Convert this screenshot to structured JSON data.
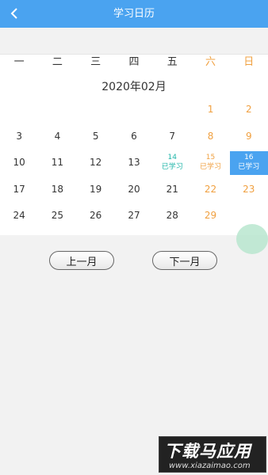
{
  "header": {
    "title": "学习日历",
    "back_icon": "chevron-left-icon"
  },
  "weekdays": [
    {
      "label": "一",
      "weekend": false
    },
    {
      "label": "二",
      "weekend": false
    },
    {
      "label": "三",
      "weekend": false
    },
    {
      "label": "四",
      "weekend": false
    },
    {
      "label": "五",
      "weekend": false
    },
    {
      "label": "六",
      "weekend": true
    },
    {
      "label": "日",
      "weekend": true
    }
  ],
  "calendar": {
    "month_label": "2020年02月",
    "studied_label": "已学习",
    "days": [
      {
        "day": "1",
        "col": 5,
        "row": 0,
        "weekend": true
      },
      {
        "day": "2",
        "col": 6,
        "row": 0,
        "weekend": true
      },
      {
        "day": "3",
        "col": 0,
        "row": 1
      },
      {
        "day": "4",
        "col": 1,
        "row": 1
      },
      {
        "day": "5",
        "col": 2,
        "row": 1
      },
      {
        "day": "6",
        "col": 3,
        "row": 1
      },
      {
        "day": "7",
        "col": 4,
        "row": 1
      },
      {
        "day": "8",
        "col": 5,
        "row": 1,
        "weekend": true
      },
      {
        "day": "9",
        "col": 6,
        "row": 1,
        "weekend": true
      },
      {
        "day": "10",
        "col": 0,
        "row": 2
      },
      {
        "day": "11",
        "col": 1,
        "row": 2
      },
      {
        "day": "12",
        "col": 2,
        "row": 2
      },
      {
        "day": "13",
        "col": 3,
        "row": 2
      },
      {
        "day": "14",
        "col": 4,
        "row": 2,
        "studied": true,
        "style": "teal"
      },
      {
        "day": "15",
        "col": 5,
        "row": 2,
        "studied": true,
        "weekend": true
      },
      {
        "day": "16",
        "col": 6,
        "row": 2,
        "studied": true,
        "selected": true
      },
      {
        "day": "17",
        "col": 0,
        "row": 3
      },
      {
        "day": "18",
        "col": 1,
        "row": 3
      },
      {
        "day": "19",
        "col": 2,
        "row": 3
      },
      {
        "day": "20",
        "col": 3,
        "row": 3
      },
      {
        "day": "21",
        "col": 4,
        "row": 3
      },
      {
        "day": "22",
        "col": 5,
        "row": 3,
        "weekend": true
      },
      {
        "day": "23",
        "col": 6,
        "row": 3,
        "weekend": true
      },
      {
        "day": "24",
        "col": 0,
        "row": 4
      },
      {
        "day": "25",
        "col": 1,
        "row": 4
      },
      {
        "day": "26",
        "col": 2,
        "row": 4
      },
      {
        "day": "27",
        "col": 3,
        "row": 4
      },
      {
        "day": "28",
        "col": 4,
        "row": 4
      },
      {
        "day": "29",
        "col": 5,
        "row": 4,
        "weekend": true
      }
    ]
  },
  "buttons": {
    "prev": "上一月",
    "next": "下一月"
  },
  "watermark": {
    "title": "下载马应用",
    "url": "www.xiazaimao.com"
  },
  "colors": {
    "accent": "#4aa3f0",
    "weekend": "#f0a040",
    "studied": "#1fb5a8"
  }
}
